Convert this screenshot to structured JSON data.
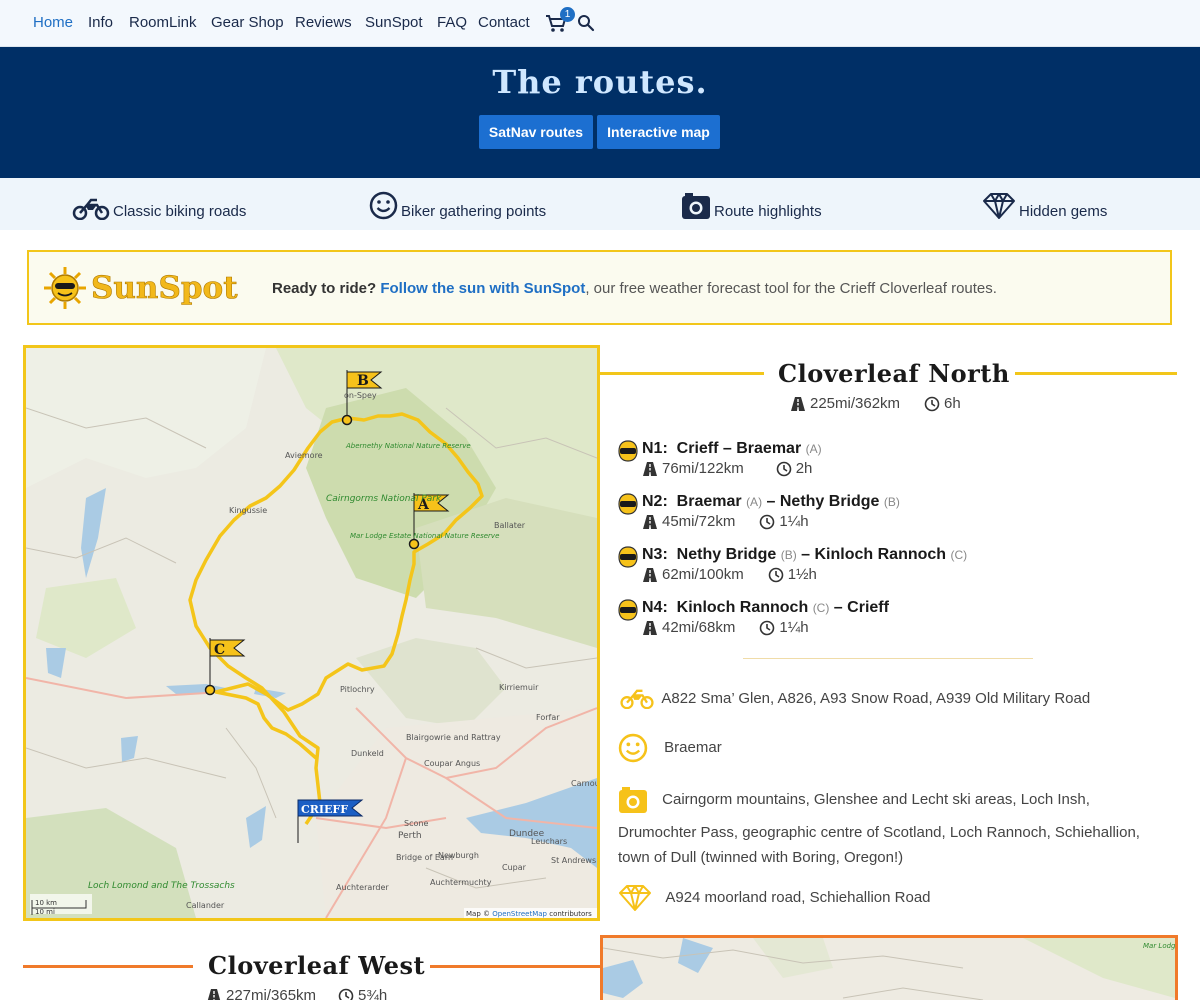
{
  "nav": {
    "items": [
      "Home",
      "Info",
      "RoomLink",
      "Gear Shop",
      "Reviews",
      "SunSpot",
      "FAQ",
      "Contact"
    ],
    "cart_count": "1"
  },
  "hero": {
    "title": "The routes.",
    "buttons": [
      "SatNav routes",
      "Interactive map"
    ]
  },
  "features": [
    "Classic biking roads",
    "Biker gathering points",
    "Route highlights",
    "Hidden gems"
  ],
  "sunspot": {
    "logo": "SunSpot",
    "lead": "Ready to ride?",
    "link": "Follow the sun with SunSpot",
    "rest": ", our free weather forecast tool for the Crieff Cloverleaf routes."
  },
  "north": {
    "title": "Cloverleaf North",
    "distance": "225mi/362km",
    "time": "6h",
    "legs": [
      {
        "id": "N1:",
        "from": "Crieff",
        "from_tag": "",
        "to": "Braemar",
        "to_tag": "(A)",
        "distance": "76mi/122km",
        "time": "2h"
      },
      {
        "id": "N2:",
        "from": "Braemar",
        "from_tag": "(A)",
        "to": "Nethy Bridge",
        "to_tag": "(B)",
        "distance": "45mi/72km",
        "time": "1¼h"
      },
      {
        "id": "N3:",
        "from": "Nethy Bridge",
        "from_tag": "(B)",
        "to": "Kinloch Rannoch",
        "to_tag": "(C)",
        "distance": "62mi/100km",
        "time": "1½h"
      },
      {
        "id": "N4:",
        "from": "Kinloch Rannoch",
        "from_tag": "(C)",
        "to": "Crieff",
        "to_tag": "",
        "distance": "42mi/68km",
        "time": "1¼h"
      }
    ],
    "roads": "A822 Sma’ Glen, A826, A93 Snow Road, A939 Old Military Road",
    "gathering": "Braemar",
    "highlights_1": "Cairngorm mountains, Glenshee and Lecht ski areas, Loch Insh,",
    "highlights_2": "Drumochter Pass, geographic centre of Scotland, Loch Rannoch, Schiehallion,",
    "highlights_3": "town of Dull (twinned with Boring, Oregon!)",
    "gems": "A924 moorland road, Schiehallion Road"
  },
  "map": {
    "flags": [
      "B",
      "A",
      "C",
      "CRIEFF"
    ],
    "labels": [
      "on-Spey",
      "Aviemore",
      "Kingussie",
      "Cairngorms National Park",
      "Abernethy National Nature Reserve",
      "Mar Lodge Estate National Nature Reserve",
      "Ballater",
      "Pitlochry",
      "Kirriemuir",
      "Forfar",
      "Blairgowrie and Rattray",
      "Coupar Angus",
      "Dunkeld",
      "Dundee",
      "Perth",
      "Scone",
      "Leuchars",
      "St Andrews",
      "Newburgh",
      "Bridge of Earn",
      "Cupar",
      "Auchterarder",
      "Auchtermuchty",
      "Loch Lomond and The Trossachs",
      "Callander",
      "Carnoustie"
    ],
    "scale_km": "10 km",
    "scale_mi": "10 mi",
    "attribution_prefix": "Map ©",
    "attribution_link": "OpenStreetMap",
    "attribution_suffix": "contributors"
  },
  "west": {
    "title": "Cloverleaf West",
    "distance": "227mi/365km",
    "time": "5¾h"
  },
  "map2_label": "Mar Lodge Estate National Nature Reserve",
  "colors": {
    "nav_bg": "#f3f8fd",
    "hero_bg": "#002f66",
    "accent_blue": "#1c6fd1",
    "yellow": "#f2c61a",
    "orange": "#f07a2a"
  }
}
